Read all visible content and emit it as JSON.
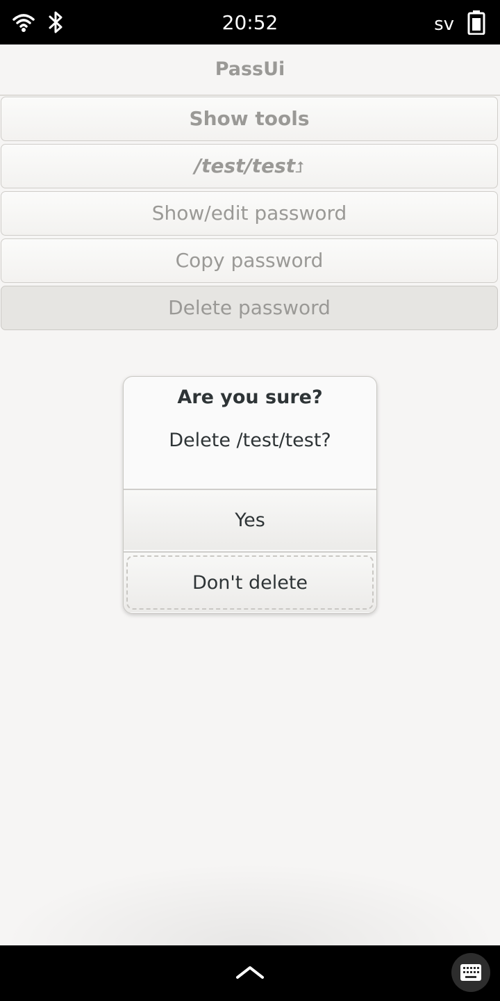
{
  "status_bar": {
    "time": "20:52",
    "language": "sv",
    "icons": [
      "wifi-icon",
      "bluetooth-icon",
      "battery-icon"
    ]
  },
  "header": {
    "title": "PassUi"
  },
  "menu": {
    "show_tools": "Show tools",
    "path": "/test/test",
    "path_return_glyph": "⮥",
    "show_edit_password": "Show/edit password",
    "copy_password": "Copy password",
    "delete_password": "Delete password"
  },
  "dialog": {
    "title": "Are you sure?",
    "message": "Delete /test/test?",
    "confirm_label": "Yes",
    "cancel_label": "Don't delete"
  },
  "nav_bar": {
    "icons": [
      "chevron-up-icon",
      "keyboard-icon"
    ]
  }
}
